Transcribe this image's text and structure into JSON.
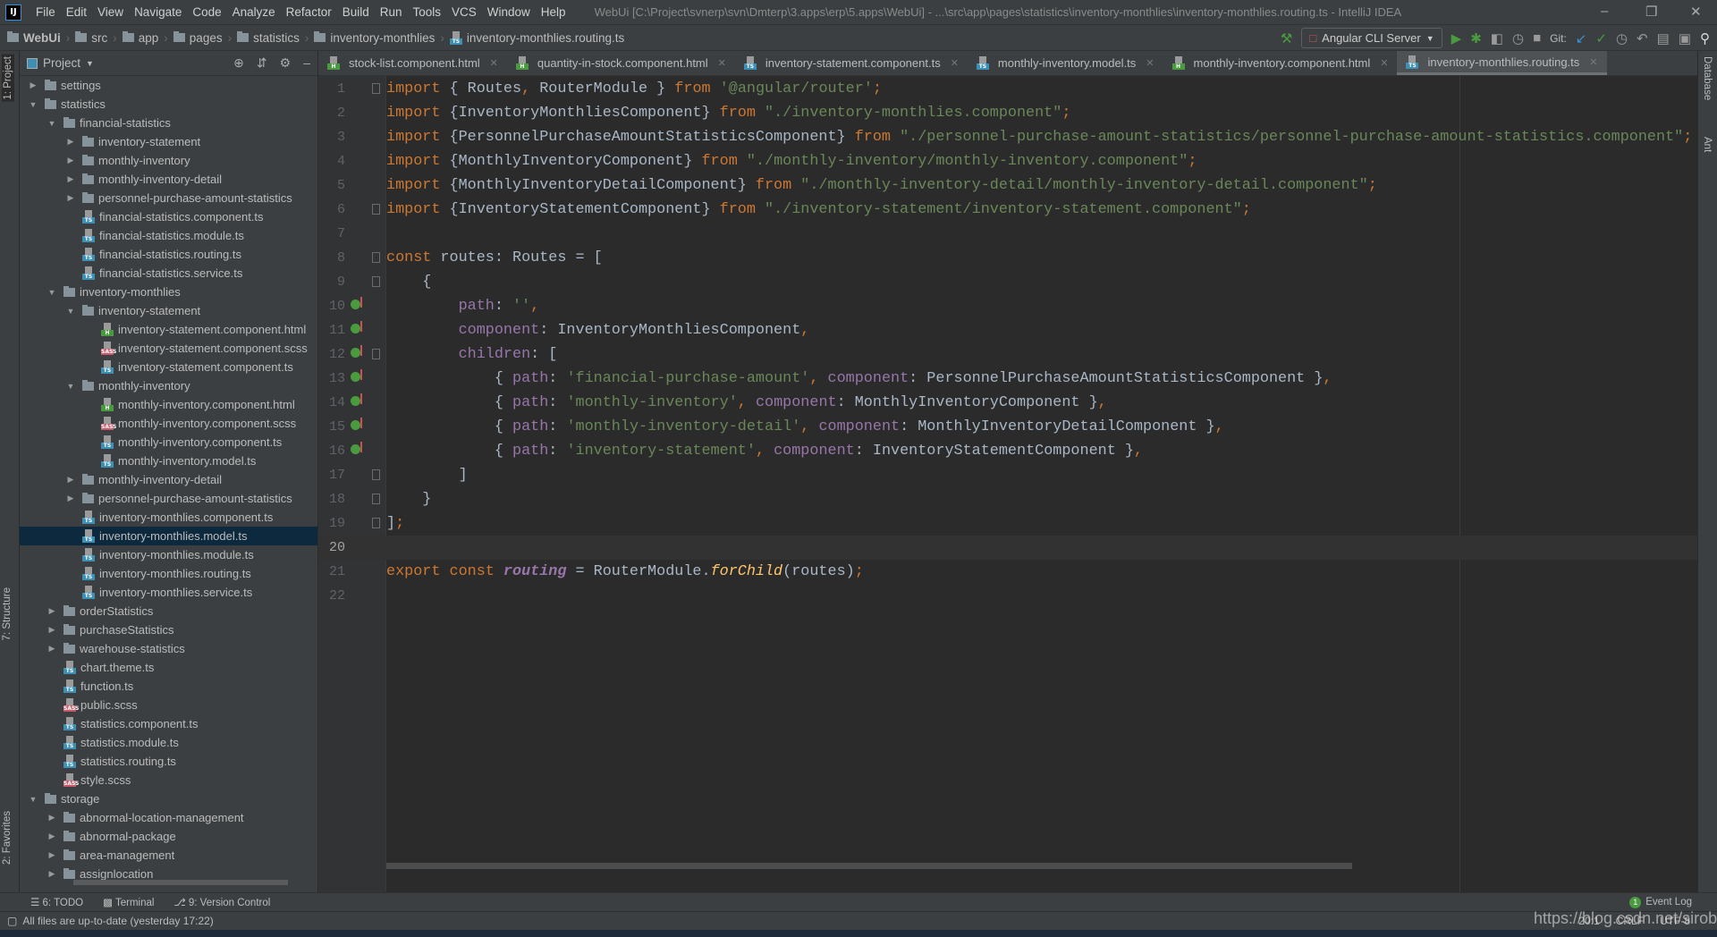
{
  "menu": {
    "items": [
      "File",
      "Edit",
      "View",
      "Navigate",
      "Code",
      "Analyze",
      "Refactor",
      "Build",
      "Run",
      "Tools",
      "VCS",
      "Window",
      "Help"
    ],
    "window_title": "WebUi [C:\\Project\\svnerp\\svn\\Dmterp\\3.apps\\erp\\5.apps\\WebUi] - ...\\src\\app\\pages\\statistics\\inventory-monthlies\\inventory-monthlies.routing.ts - IntelliJ IDEA",
    "logo": "IJ"
  },
  "breadcrumb": [
    "WebUi",
    "src",
    "app",
    "pages",
    "statistics",
    "inventory-monthlies",
    "inventory-monthlies.routing.ts"
  ],
  "toolbar": {
    "run_config": "Angular CLI Server",
    "git_label": "Git:"
  },
  "side": {
    "left": [
      "1: Project",
      "7: Structure",
      "2: Favorites"
    ],
    "right": [
      "Database",
      "Ant"
    ]
  },
  "project": {
    "title": "Project",
    "tree": [
      {
        "l": 0,
        "t": "d",
        "o": false,
        "n": "settings"
      },
      {
        "l": 0,
        "t": "d",
        "o": true,
        "n": "statistics"
      },
      {
        "l": 1,
        "t": "d",
        "o": true,
        "n": "financial-statistics"
      },
      {
        "l": 2,
        "t": "d",
        "o": false,
        "n": "inventory-statement"
      },
      {
        "l": 2,
        "t": "d",
        "o": false,
        "n": "monthly-inventory"
      },
      {
        "l": 2,
        "t": "d",
        "o": false,
        "n": "monthly-inventory-detail"
      },
      {
        "l": 2,
        "t": "d",
        "o": false,
        "n": "personnel-purchase-amount-statistics"
      },
      {
        "l": 2,
        "t": "ts",
        "n": "financial-statistics.component.ts"
      },
      {
        "l": 2,
        "t": "ts",
        "n": "financial-statistics.module.ts"
      },
      {
        "l": 2,
        "t": "ts",
        "n": "financial-statistics.routing.ts"
      },
      {
        "l": 2,
        "t": "ts",
        "n": "financial-statistics.service.ts"
      },
      {
        "l": 1,
        "t": "d",
        "o": true,
        "n": "inventory-monthlies"
      },
      {
        "l": 2,
        "t": "d",
        "o": true,
        "n": "inventory-statement"
      },
      {
        "l": 3,
        "t": "html",
        "n": "inventory-statement.component.html"
      },
      {
        "l": 3,
        "t": "scss",
        "n": "inventory-statement.component.scss"
      },
      {
        "l": 3,
        "t": "ts",
        "n": "inventory-statement.component.ts"
      },
      {
        "l": 2,
        "t": "d",
        "o": true,
        "n": "monthly-inventory"
      },
      {
        "l": 3,
        "t": "html",
        "n": "monthly-inventory.component.html"
      },
      {
        "l": 3,
        "t": "scss",
        "n": "monthly-inventory.component.scss"
      },
      {
        "l": 3,
        "t": "ts",
        "n": "monthly-inventory.component.ts"
      },
      {
        "l": 3,
        "t": "ts",
        "n": "monthly-inventory.model.ts"
      },
      {
        "l": 2,
        "t": "d",
        "o": false,
        "n": "monthly-inventory-detail"
      },
      {
        "l": 2,
        "t": "d",
        "o": false,
        "n": "personnel-purchase-amount-statistics"
      },
      {
        "l": 2,
        "t": "ts",
        "n": "inventory-monthlies.component.ts"
      },
      {
        "l": 2,
        "t": "ts",
        "n": "inventory-monthlies.model.ts",
        "sel": true
      },
      {
        "l": 2,
        "t": "ts",
        "n": "inventory-monthlies.module.ts"
      },
      {
        "l": 2,
        "t": "ts",
        "n": "inventory-monthlies.routing.ts"
      },
      {
        "l": 2,
        "t": "ts",
        "n": "inventory-monthlies.service.ts"
      },
      {
        "l": 1,
        "t": "d",
        "o": false,
        "n": "orderStatistics"
      },
      {
        "l": 1,
        "t": "d",
        "o": false,
        "n": "purchaseStatistics"
      },
      {
        "l": 1,
        "t": "d",
        "o": false,
        "n": "warehouse-statistics"
      },
      {
        "l": 1,
        "t": "ts",
        "n": "chart.theme.ts"
      },
      {
        "l": 1,
        "t": "ts",
        "n": "function.ts"
      },
      {
        "l": 1,
        "t": "scss",
        "n": "public.scss"
      },
      {
        "l": 1,
        "t": "ts",
        "n": "statistics.component.ts"
      },
      {
        "l": 1,
        "t": "ts",
        "n": "statistics.module.ts"
      },
      {
        "l": 1,
        "t": "ts",
        "n": "statistics.routing.ts"
      },
      {
        "l": 1,
        "t": "scss",
        "n": "style.scss"
      },
      {
        "l": 0,
        "t": "d",
        "o": true,
        "n": "storage"
      },
      {
        "l": 1,
        "t": "d",
        "o": false,
        "n": "abnormal-location-management"
      },
      {
        "l": 1,
        "t": "d",
        "o": false,
        "n": "abnormal-package"
      },
      {
        "l": 1,
        "t": "d",
        "o": false,
        "n": "area-management"
      },
      {
        "l": 1,
        "t": "d",
        "o": false,
        "n": "assignlocation"
      }
    ]
  },
  "file_labels": {
    "ts": "TS",
    "html": "H",
    "scss": "SASS"
  },
  "file_colors": {
    "ts": "#3d8fb4",
    "html": "#4a9b3f",
    "scss": "#c75a6a"
  },
  "tabs": [
    {
      "n": "stock-list.component.html",
      "t": "html"
    },
    {
      "n": "quantity-in-stock.component.html",
      "t": "html"
    },
    {
      "n": "inventory-statement.component.ts",
      "t": "ts"
    },
    {
      "n": "monthly-inventory.model.ts",
      "t": "ts"
    },
    {
      "n": "monthly-inventory.component.html",
      "t": "html"
    },
    {
      "n": "inventory-monthlies.routing.ts",
      "t": "ts",
      "active": true
    }
  ],
  "editor": {
    "current_line": 20,
    "override_lines": [
      10,
      11,
      12,
      13,
      14,
      15,
      16
    ],
    "fold_lines": [
      1,
      6,
      8,
      9,
      12,
      17,
      18,
      19
    ],
    "lines": [
      [
        [
          "k",
          "import"
        ],
        [
          "t",
          " { Routes"
        ],
        [
          "o",
          ","
        ],
        [
          "t",
          " RouterModule } "
        ],
        [
          "k",
          "from"
        ],
        [
          "t",
          " "
        ],
        [
          "s",
          "'@angular/router'"
        ],
        [
          "o",
          ";"
        ]
      ],
      [
        [
          "k",
          "import"
        ],
        [
          "t",
          " {InventoryMonthliesComponent} "
        ],
        [
          "k",
          "from"
        ],
        [
          "t",
          " "
        ],
        [
          "s",
          "\"./inventory-monthlies.component\""
        ],
        [
          "o",
          ";"
        ]
      ],
      [
        [
          "k",
          "import"
        ],
        [
          "t",
          " {PersonnelPurchaseAmountStatisticsComponent} "
        ],
        [
          "k",
          "from"
        ],
        [
          "t",
          " "
        ],
        [
          "s",
          "\"./personnel-purchase-amount-statistics/personnel-purchase-amount-statistics.component\""
        ],
        [
          "o",
          ";"
        ]
      ],
      [
        [
          "k",
          "import"
        ],
        [
          "t",
          " {MonthlyInventoryComponent} "
        ],
        [
          "k",
          "from"
        ],
        [
          "t",
          " "
        ],
        [
          "s",
          "\"./monthly-inventory/monthly-inventory.component\""
        ],
        [
          "o",
          ";"
        ]
      ],
      [
        [
          "k",
          "import"
        ],
        [
          "t",
          " {MonthlyInventoryDetailComponent} "
        ],
        [
          "k",
          "from"
        ],
        [
          "t",
          " "
        ],
        [
          "s",
          "\"./monthly-inventory-detail/monthly-inventory-detail.component\""
        ],
        [
          "o",
          ";"
        ]
      ],
      [
        [
          "k",
          "import"
        ],
        [
          "t",
          " {InventoryStatementComponent} "
        ],
        [
          "k",
          "from"
        ],
        [
          "t",
          " "
        ],
        [
          "s",
          "\"./inventory-statement/inventory-statement.component\""
        ],
        [
          "o",
          ";"
        ]
      ],
      [],
      [
        [
          "k",
          "const"
        ],
        [
          "t",
          " routes: Routes = ["
        ]
      ],
      [
        [
          "t",
          "    {"
        ]
      ],
      [
        [
          "t",
          "        "
        ],
        [
          "p",
          "path"
        ],
        [
          "t",
          ": "
        ],
        [
          "s",
          "''"
        ],
        [
          "o",
          ","
        ]
      ],
      [
        [
          "t",
          "        "
        ],
        [
          "p",
          "component"
        ],
        [
          "t",
          ": InventoryMonthliesComponent"
        ],
        [
          "o",
          ","
        ]
      ],
      [
        [
          "t",
          "        "
        ],
        [
          "p",
          "children"
        ],
        [
          "t",
          ": ["
        ]
      ],
      [
        [
          "t",
          "            { "
        ],
        [
          "p",
          "path"
        ],
        [
          "t",
          ": "
        ],
        [
          "s",
          "'financial-purchase-amount'"
        ],
        [
          "o",
          ", "
        ],
        [
          "p",
          "component"
        ],
        [
          "t",
          ": PersonnelPurchaseAmountStatisticsComponent }"
        ],
        [
          "o",
          ","
        ]
      ],
      [
        [
          "t",
          "            { "
        ],
        [
          "p",
          "path"
        ],
        [
          "t",
          ": "
        ],
        [
          "s",
          "'monthly-inventory'"
        ],
        [
          "o",
          ", "
        ],
        [
          "p",
          "component"
        ],
        [
          "t",
          ": MonthlyInventoryComponent }"
        ],
        [
          "o",
          ","
        ]
      ],
      [
        [
          "t",
          "            { "
        ],
        [
          "p",
          "path"
        ],
        [
          "t",
          ": "
        ],
        [
          "s",
          "'monthly-inventory-detail'"
        ],
        [
          "o",
          ", "
        ],
        [
          "p",
          "component"
        ],
        [
          "t",
          ": MonthlyInventoryDetailComponent }"
        ],
        [
          "o",
          ","
        ]
      ],
      [
        [
          "t",
          "            { "
        ],
        [
          "p",
          "path"
        ],
        [
          "t",
          ": "
        ],
        [
          "s",
          "'inventory-statement'"
        ],
        [
          "o",
          ", "
        ],
        [
          "p",
          "component"
        ],
        [
          "t",
          ": InventoryStatementComponent }"
        ],
        [
          "o",
          ","
        ]
      ],
      [
        [
          "t",
          "        ]"
        ]
      ],
      [
        [
          "t",
          "    }"
        ]
      ],
      [
        [
          "t",
          "]"
        ],
        [
          "o",
          ";"
        ]
      ],
      [],
      [
        [
          "k",
          "export const "
        ],
        [
          "v",
          "routing"
        ],
        [
          "t",
          " = RouterModule."
        ],
        [
          "f",
          "forChild"
        ],
        [
          "t",
          "(routes)"
        ],
        [
          "o",
          ";"
        ]
      ],
      []
    ]
  },
  "bottom_tabs": [
    "6: TODO",
    "Terminal",
    "9: Version Control"
  ],
  "event_log": {
    "label": "Event Log",
    "count": "1"
  },
  "status": {
    "message": "All files are up-to-date (yesterday 17:22)",
    "position": "20:1",
    "line_sep": "CRLF",
    "encoding": "UTF-8"
  },
  "watermark": "https://blog.csdn.net/sirobot"
}
